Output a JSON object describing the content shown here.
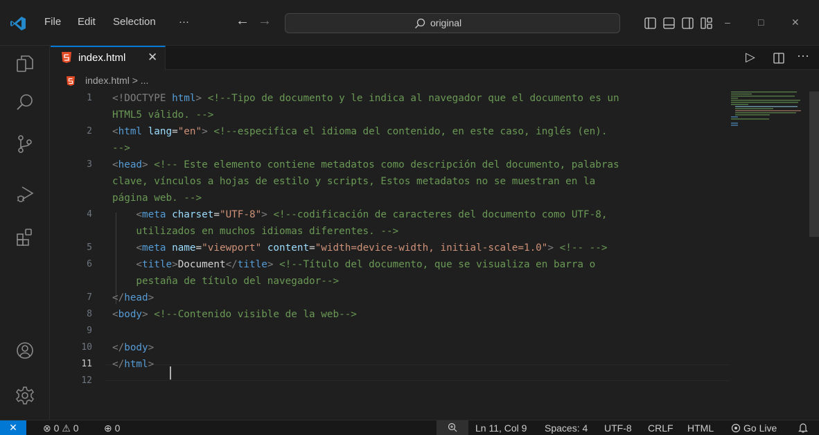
{
  "titlebar": {
    "menu": [
      "File",
      "Edit",
      "Selection",
      "···"
    ],
    "back": "←",
    "forward": "→",
    "search_text": "original",
    "window_controls": [
      "–",
      "□",
      "✕"
    ]
  },
  "tab": {
    "label": "index.html",
    "close": "✕"
  },
  "editor_actions": [
    "▷",
    "···"
  ],
  "breadcrumb": "index.html > ...",
  "editor": {
    "line_numbers": [
      "1",
      "",
      "2",
      "",
      "3",
      "",
      "",
      "4",
      "",
      "5",
      "6",
      "",
      "7",
      "8",
      "9",
      "10",
      "11",
      "12"
    ],
    "active_line": "11",
    "lines": [
      [
        [
          "&lt;!DOCTYPE ",
          "punc"
        ],
        [
          "html",
          "tag"
        ],
        [
          "&gt; ",
          "punc"
        ],
        [
          "&lt;!--Tipo de documento y le indica al navegador que el documento es un",
          "com"
        ]
      ],
      [
        [
          "HTML5 válido. --&gt;",
          "com"
        ]
      ],
      [
        [
          "&lt;",
          "punc"
        ],
        [
          "html",
          "tag"
        ],
        [
          " lang",
          "attr"
        ],
        [
          "=",
          "txt"
        ],
        [
          "\"en\"",
          "str"
        ],
        [
          "&gt; ",
          "punc"
        ],
        [
          "&lt;!--especifica el idioma del contenido, en este caso, inglés (en).",
          "com"
        ]
      ],
      [
        [
          "--&gt;",
          "com"
        ]
      ],
      [
        [
          "&lt;",
          "punc"
        ],
        [
          "head",
          "tag"
        ],
        [
          "&gt; ",
          "punc"
        ],
        [
          "&lt;!-- Este elemento contiene metadatos como descripción del documento, palabras",
          "com"
        ]
      ],
      [
        [
          "clave, vínculos a hojas de estilo y scripts, Estos metadatos no se muestran en la",
          "com"
        ]
      ],
      [
        [
          "página web. --&gt;",
          "com"
        ]
      ],
      [
        [
          "    &lt;",
          "punc"
        ],
        [
          "meta",
          "tag"
        ],
        [
          " charset",
          "attr"
        ],
        [
          "=",
          "txt"
        ],
        [
          "\"UTF-8\"",
          "str"
        ],
        [
          "&gt; ",
          "punc"
        ],
        [
          "&lt;!--codificación de caracteres del documento como UTF-8,",
          "com"
        ]
      ],
      [
        [
          "    utilizados en muchos idiomas diferentes. --&gt;",
          "com"
        ]
      ],
      [
        [
          "    &lt;",
          "punc"
        ],
        [
          "meta",
          "tag"
        ],
        [
          " name",
          "attr"
        ],
        [
          "=",
          "txt"
        ],
        [
          "\"viewport\"",
          "str"
        ],
        [
          " content",
          "attr"
        ],
        [
          "=",
          "txt"
        ],
        [
          "\"width=device-width, initial-scale=1.0\"",
          "str"
        ],
        [
          "&gt; ",
          "punc"
        ],
        [
          "&lt;!-- --&gt;",
          "com"
        ]
      ],
      [
        [
          "    &lt;",
          "punc"
        ],
        [
          "title",
          "tag"
        ],
        [
          "&gt;",
          "punc"
        ],
        [
          "Document",
          "txt"
        ],
        [
          "&lt;/",
          "punc"
        ],
        [
          "title",
          "tag"
        ],
        [
          "&gt; ",
          "punc"
        ],
        [
          "&lt;!--Título del documento, que se visualiza en barra o",
          "com"
        ]
      ],
      [
        [
          "    pestaña de título del navegador--&gt;",
          "com"
        ]
      ],
      [
        [
          "&lt;/",
          "punc"
        ],
        [
          "head",
          "tag"
        ],
        [
          "&gt;",
          "punc"
        ]
      ],
      [
        [
          "&lt;",
          "punc"
        ],
        [
          "body",
          "tag"
        ],
        [
          "&gt; ",
          "punc"
        ],
        [
          "&lt;!--Contenido visible de la web--&gt;",
          "com"
        ]
      ],
      [
        [
          "",
          "txt"
        ]
      ],
      [
        [
          "&lt;/",
          "punc"
        ],
        [
          "body",
          "tag"
        ],
        [
          "&gt;",
          "punc"
        ]
      ],
      [
        [
          "&lt;/",
          "punc"
        ],
        [
          "html",
          "tag"
        ],
        [
          "&gt;",
          "punc"
        ]
      ],
      [
        [
          "",
          "txt"
        ]
      ]
    ]
  },
  "statusbar": {
    "remote": "✕",
    "problems": "⊗ 0 ⚠ 0",
    "ports": "⊕ 0",
    "position": "Ln 11, Col 9",
    "spaces": "Spaces: 4",
    "encoding": "UTF-8",
    "eol": "CRLF",
    "language": "HTML",
    "golive": "Go Live"
  },
  "colors": {
    "accent": "#0078d4",
    "html_icon": "#e44d26"
  }
}
